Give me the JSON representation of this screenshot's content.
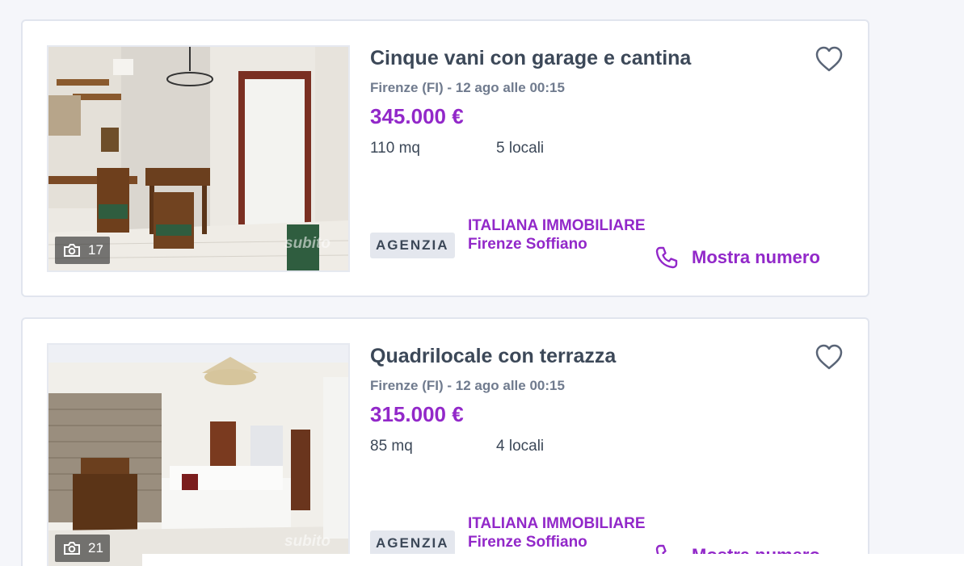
{
  "listings": [
    {
      "title": "Cinque vani con garage e cantina",
      "location": "Firenze (FI)",
      "date": "12 ago alle 00:15",
      "price": "345.000 €",
      "size": "110 mq",
      "rooms": "5 locali",
      "photo_count": "17",
      "watermark": "subito",
      "badge": "AGENZIA",
      "agency": "ITALIANA IMMOBILIARE Firenze Soffiano",
      "phone_label": "Mostra numero"
    },
    {
      "title": "Quadrilocale con terrazza",
      "location": "Firenze (FI)",
      "date": "12 ago alle 00:15",
      "price": "315.000 €",
      "size": "85 mq",
      "rooms": "4 locali",
      "photo_count": "21",
      "watermark": "subito",
      "badge": "AGENZIA",
      "agency": "ITALIANA IMMOBILIARE Firenze Soffiano",
      "phone_label": "Mostra numero"
    }
  ],
  "meta_separator": " - ",
  "colors": {
    "accent": "#9228c9",
    "text": "#3c4858",
    "muted": "#707b8e",
    "badge_bg": "#e4e7ee"
  },
  "icons": {
    "favorite": "heart-icon",
    "photos": "camera-icon",
    "phone": "phone-icon"
  }
}
